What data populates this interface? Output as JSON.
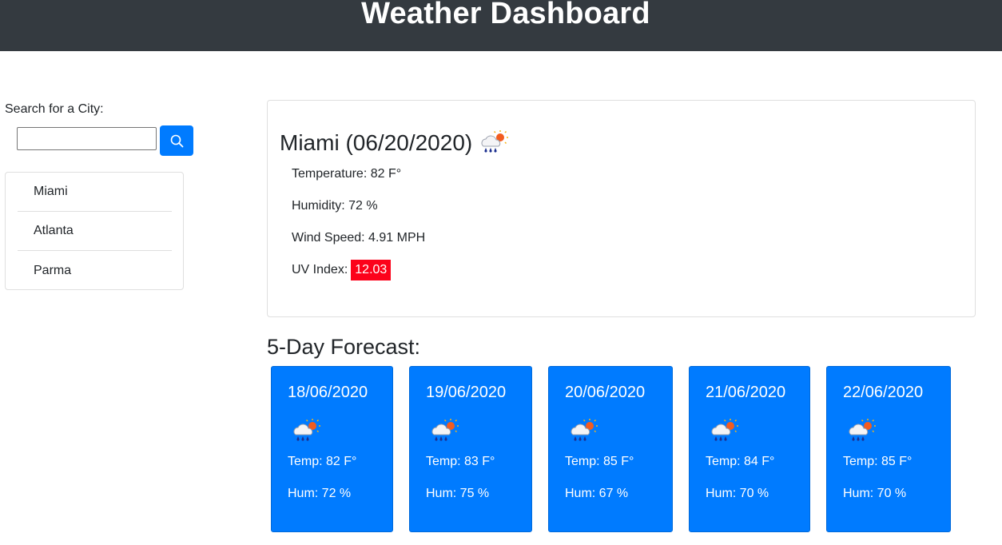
{
  "header": {
    "title": "Weather Dashboard"
  },
  "search": {
    "label": "Search for a City:",
    "value": "",
    "placeholder": "",
    "button_icon": "search-icon"
  },
  "history": [
    {
      "name": "Miami"
    },
    {
      "name": "Atlanta"
    },
    {
      "name": "Parma"
    }
  ],
  "current": {
    "title": "Miami (06/20/2020)",
    "icon": "rain-sun-icon",
    "temperature": "Temperature: 82 F°",
    "humidity": "Humidity: 72 %",
    "wind": "Wind Speed: 4.91 MPH",
    "uv_label": "UV Index:",
    "uv_value": "12.03",
    "uv_color": "#fc021b"
  },
  "forecast": {
    "title": "5-Day Forecast:",
    "card_color": "#007bff",
    "days": [
      {
        "date": "18/06/2020",
        "icon": "rain-sun-icon",
        "temp": "Temp: 82 F°",
        "hum": "Hum: 72 %"
      },
      {
        "date": "19/06/2020",
        "icon": "rain-sun-icon",
        "temp": "Temp: 83 F°",
        "hum": "Hum: 75 %"
      },
      {
        "date": "20/06/2020",
        "icon": "rain-sun-icon",
        "temp": "Temp: 85 F°",
        "hum": "Hum: 67 %"
      },
      {
        "date": "21/06/2020",
        "icon": "rain-sun-icon",
        "temp": "Temp: 84 F°",
        "hum": "Hum: 70 %"
      },
      {
        "date": "22/06/2020",
        "icon": "rain-sun-icon",
        "temp": "Temp: 85 F°",
        "hum": "Hum: 70 %"
      }
    ]
  }
}
